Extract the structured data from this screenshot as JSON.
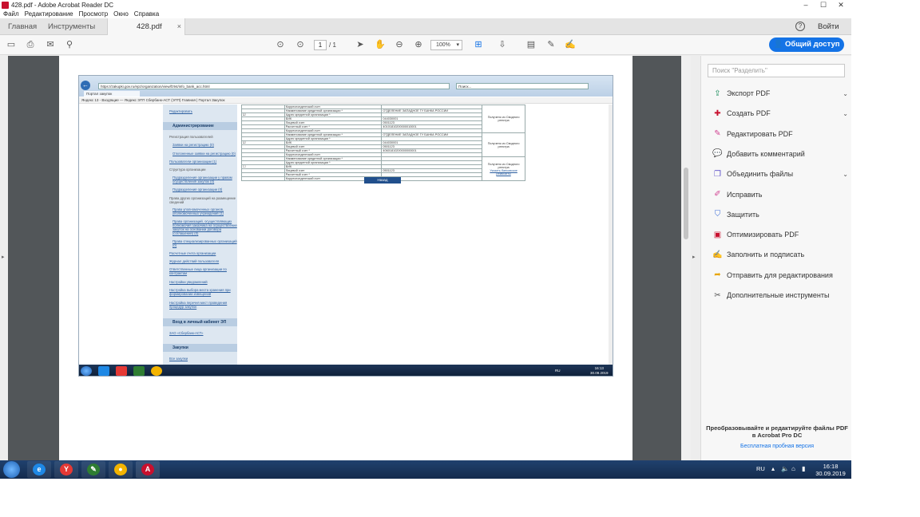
{
  "window": {
    "title": "428.pdf - Adobe Acrobat Reader DC",
    "minimize": "–",
    "maximize": "☐",
    "close": "✕"
  },
  "menu": [
    "Файл",
    "Редактирование",
    "Просмотр",
    "Окно",
    "Справка"
  ],
  "tabs": {
    "home": "Главная",
    "tools": "Инструменты",
    "doc": "428.pdf",
    "doc_close": "×"
  },
  "header": {
    "help": "?",
    "signin": "Войти"
  },
  "toolbar": {
    "page_current": "1",
    "page_total": "/ 1",
    "zoom": "100%",
    "share": "Общий доступ"
  },
  "left_arrow": "▸",
  "right_arrow": "▸",
  "embedded": {
    "address": "https://zakupki.gov.ru/epz/organization/view/fz94/info_bank_acc.html",
    "search_placeholder": "Поиск...",
    "tab_title": "Портал закупок",
    "favorites": "Яндекс   13 - Входящие — Яндекс   ЭТП Сбербанк-АСТ (ЭТП)   Главная | Портал Закупок",
    "side": {
      "edit_link": "Редактировать",
      "admin_header": "Администрирование",
      "reg_label": "Регистрация пользователей",
      "item1": "Заявки на регистрацию (0)",
      "item2": "Отклоненные заявки на регистрацию (0)",
      "item3": "Пользователи организации (1)",
      "struct_label": "Структура организации",
      "item4": "Подразделения организации у правом осуществления закупок (0)",
      "item5": "Подразделения организации (0)",
      "rights_label": "Права других организаций на размещение сведений",
      "item6": "Права уполномоченных органов, уполномоченных учреждений (1)",
      "item7": "Права организаций, осуществляющих полномочия заказчика на осуществление закупок на основании договора (соглашения) (0)",
      "item8": "Права специализированных организаций (0)",
      "item9": "Расчетные счета организации",
      "item10": "Журнал действий пользователя",
      "item11": "Ответственные лица организации по контрактам",
      "item12": "Настройки уведомлений",
      "item13": "Настройка выбора места хранения при формировании извещений",
      "item14": "Настройка перечня мест проведения процедур закупок",
      "lk_header": "Вход в личный кабинет ЭП",
      "lk_link": "ЗАО «Сбербанк-АСТ»",
      "purchase_header": "Закупки",
      "all_link": "Все закупки"
    },
    "table": {
      "r_corr": "Корреспондентский счет",
      "r_bank_name": "Наименование кредитной организации *",
      "r_bank_addr": "Адрес кредитной организации *",
      "r_bik": "БИК",
      "r_personal": "Лицевой счет",
      "r_settlement": "Расчетный счет *",
      "bank1": "ОТДЕЛЕНИЕ ЗАПАДНОЕ ГУ БАНКА РОССИИ",
      "bank2": "ОТДЕЛЕНИЕ ЗАПАДНОЕ ГУ БАНКА РОССИИ",
      "v_bik1": "044030001",
      "v_acc1": "0501123",
      "v_sett1": "40101810200000010001",
      "v_bik2": "044030001",
      "v_acc2": "0501123",
      "v_sett2": "40601810200000000001",
      "v_acc3": "0501123",
      "note1": "Получено из Сводного реестра",
      "note2": "Получено из Сводного реестра",
      "note3": "Получено из Сводного реестра",
      "note3_link": "Указать банковские реквизиты"
    },
    "back_button": "Назад",
    "lang": "RU",
    "clock_time": "16:13",
    "clock_date": "30.09.2019"
  },
  "right_pane": {
    "search_placeholder": "Поиск \"Разделить\"",
    "tools": [
      {
        "label": "Экспорт PDF",
        "icon": "export-pdf-icon",
        "color": "#1f8f5f"
      },
      {
        "label": "Создать PDF",
        "icon": "create-pdf-icon",
        "color": "#c8102e"
      },
      {
        "label": "Редактировать PDF",
        "icon": "edit-pdf-icon",
        "color": "#d14493"
      },
      {
        "label": "Добавить комментарий",
        "icon": "comment-icon",
        "color": "#e8a500"
      },
      {
        "label": "Объединить файлы",
        "icon": "combine-icon",
        "color": "#5b4dc8"
      },
      {
        "label": "Исправить",
        "icon": "fix-icon",
        "color": "#d14493"
      },
      {
        "label": "Защитить",
        "icon": "protect-icon",
        "color": "#3f6fd8"
      },
      {
        "label": "Оптимизировать PDF",
        "icon": "optimize-icon",
        "color": "#c8102e"
      },
      {
        "label": "Заполнить и подписать",
        "icon": "fill-sign-icon",
        "color": "#7b4fd0"
      },
      {
        "label": "Отправить для редактирования",
        "icon": "send-review-icon",
        "color": "#e8a500"
      },
      {
        "label": "Дополнительные инструменты",
        "icon": "more-tools-icon",
        "color": "#555555"
      }
    ],
    "promo": "Преобразовывайте и редактируйте файлы PDF в Acrobat Pro DC",
    "promo_link": "Бесплатная пробная версия"
  },
  "taskbar": {
    "lang": "RU",
    "time": "16:18",
    "date": "30.09.2019",
    "apps": [
      {
        "name": "ie",
        "glyph": "e",
        "color": "#1e88e5"
      },
      {
        "name": "yandex",
        "glyph": "Y",
        "color": "#e53935"
      },
      {
        "name": "excel-like",
        "glyph": "✎",
        "color": "#2e7d32"
      },
      {
        "name": "chrome",
        "glyph": "●",
        "color": "#f4b400"
      },
      {
        "name": "acrobat",
        "glyph": "A",
        "color": "#c8102e"
      }
    ]
  }
}
